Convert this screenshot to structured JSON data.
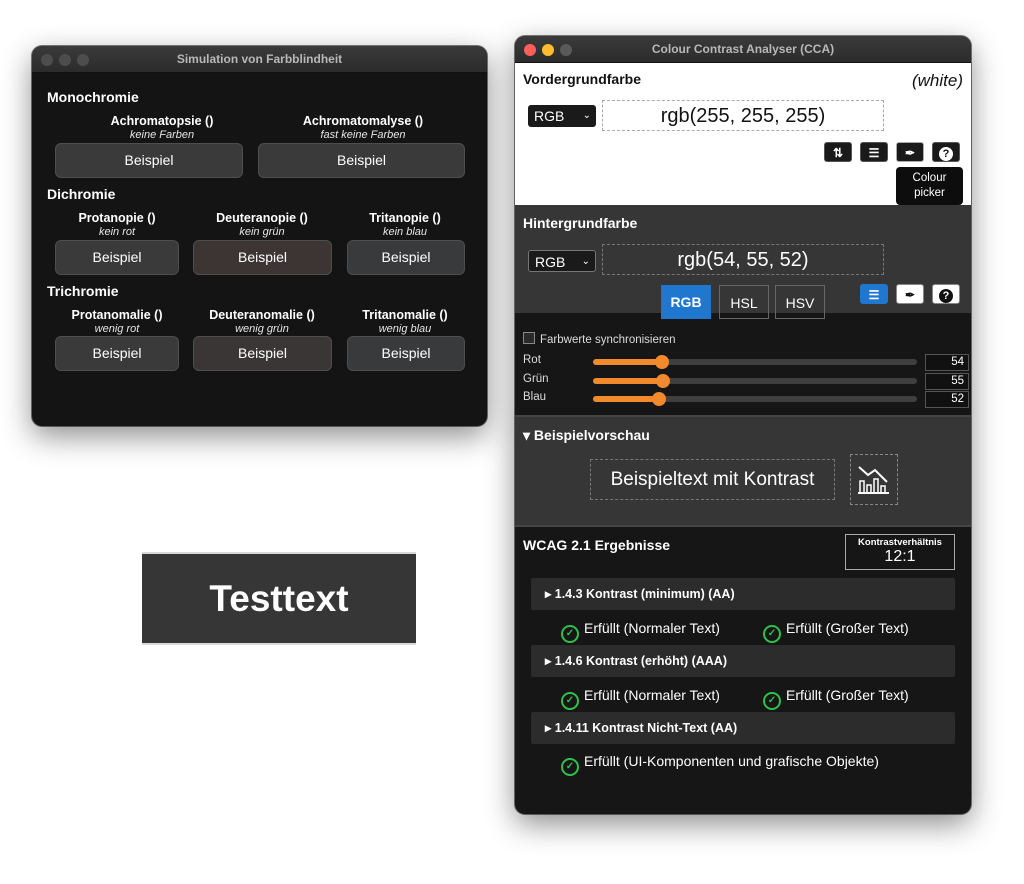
{
  "simulation_window": {
    "title": "Simulation von Farbblindheit",
    "sections": {
      "monochromie": "Monochromie",
      "dichromie": "Dichromie",
      "trichromie": "Trichromie"
    },
    "items": [
      {
        "name": "Achromatopsie ()",
        "desc": "keine Farben",
        "button": "Beispiel"
      },
      {
        "name": "Achromatomalyse ()",
        "desc": "fast keine Farben",
        "button": "Beispiel"
      },
      {
        "name": "Protanopie ()",
        "desc": "kein rot",
        "button": "Beispiel"
      },
      {
        "name": "Deuteranopie ()",
        "desc": "kein grün",
        "button": "Beispiel"
      },
      {
        "name": "Tritanopie ()",
        "desc": "kein blau",
        "button": "Beispiel"
      },
      {
        "name": "Protanomalie ()",
        "desc": "wenig rot",
        "button": "Beispiel"
      },
      {
        "name": "Deuteranomalie ()",
        "desc": "wenig grün",
        "button": "Beispiel"
      },
      {
        "name": "Tritanomalie ()",
        "desc": "wenig blau",
        "button": "Beispiel"
      }
    ]
  },
  "testtext": "Testtext",
  "cca": {
    "title": "Colour Contrast Analyser (CCA)",
    "foreground": {
      "heading": "Vordergrundfarbe",
      "color_name": "(white)",
      "format": "RGB",
      "value": "rgb(255, 255, 255)",
      "tooltip": "Colour picker"
    },
    "background": {
      "heading": "Hintergrundfarbe",
      "format": "RGB",
      "value": "rgb(54, 55, 52)"
    },
    "modes": [
      "RGB",
      "HSL",
      "HSV"
    ],
    "active_mode": "RGB",
    "sync_label": "Farbwerte synchronisieren",
    "sliders": [
      {
        "label": "Rot",
        "value": 54,
        "max": 255
      },
      {
        "label": "Grün",
        "value": 55,
        "max": 255
      },
      {
        "label": "Blau",
        "value": 52,
        "max": 255
      }
    ],
    "preview": {
      "heading": "▾ Beispielvorschau",
      "sample_text": "Beispieltext mit Kontrast",
      "icon": "bar-chart-icon"
    },
    "results": {
      "heading": "WCAG 2.1 Ergebnisse",
      "ratio_label": "Kontrastverhältnis",
      "ratio_value": "12:1",
      "criteria": [
        {
          "title": "▸ 1.4.3 Kontrast (minimum) (AA)",
          "results": [
            "Erfüllt (Normaler Text)",
            "Erfüllt (Großer Text)"
          ]
        },
        {
          "title": "▸ 1.4.6 Kontrast (erhöht) (AAA)",
          "results": [
            "Erfüllt (Normaler Text)",
            "Erfüllt (Großer Text)"
          ]
        },
        {
          "title": "▸ 1.4.11 Kontrast Nicht-Text (AA)",
          "results": [
            "Erfüllt (UI-Komponenten und grafische Objekte)"
          ]
        }
      ]
    },
    "colors": {
      "accent": "#1f77d0",
      "slider": "#f08a2c",
      "ok": "#2fbf4a"
    }
  }
}
